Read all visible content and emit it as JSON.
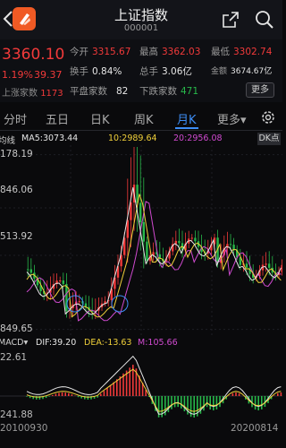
{
  "header": {
    "title": "上证指数",
    "code": "000001"
  },
  "quote": {
    "price": "3360.10",
    "change_pct": "1.19%",
    "change": "39.37",
    "up_label": "上涨家数",
    "up_value": "1173",
    "open_label": "今开",
    "open_value": "3315.67",
    "high_label": "最高",
    "high_value": "3362.03",
    "low_label": "最低",
    "low_value": "3302.74",
    "turnover_label": "换手",
    "turnover_value": "0.84%",
    "volume_label": "总手",
    "volume_value": "3.06亿",
    "amount_label": "金额",
    "amount_value": "3674.67亿",
    "flat_label": "平盘家数",
    "flat_value": "82",
    "down_label": "下跌家数",
    "down_value": "471",
    "more_label": "更多"
  },
  "tabs": [
    "分时",
    "五日",
    "日K",
    "周K",
    "月K",
    "更多▾"
  ],
  "active_tab": "月K",
  "ma_bar": {
    "label": "均线",
    "ma5": "MA5:3073.44",
    "ma10": "10:2989.64",
    "ma20": "20:2956.08",
    "dk_label": "DK点"
  },
  "axis": {
    "y1": "178.19",
    "y2": "846.06",
    "y3": "513.92",
    "y4": "849.65"
  },
  "macd_bar": {
    "label": "MACD▾",
    "dif": "DIF:39.20",
    "dea": "DEA:-13.63",
    "m": "M:105.66",
    "y_top": "22.61",
    "y_bottom": "241.88"
  },
  "dates": {
    "start": "20100930",
    "end": "20200814"
  },
  "colors": {
    "up": "#f23a3a",
    "down": "#27b84a",
    "accent": "#3d8df5",
    "ma5": "#e6e6e6",
    "ma10": "#f0d03a",
    "ma20": "#d04ad0"
  },
  "chart_data": [
    {
      "type": "line",
      "title": "",
      "series": [
        {
          "name": "MA5",
          "values": [
            3073.44
          ]
        },
        {
          "name": "MA10",
          "values": [
            2989.64
          ]
        },
        {
          "name": "MA20",
          "values": [
            2956.08
          ]
        }
      ]
    },
    {
      "type": "line",
      "title": "MACD",
      "series": [
        {
          "name": "DIF",
          "values": [
            39.2
          ]
        },
        {
          "name": "DEA",
          "values": [
            -13.63
          ]
        },
        {
          "name": "M",
          "values": [
            105.66
          ]
        }
      ]
    }
  ]
}
